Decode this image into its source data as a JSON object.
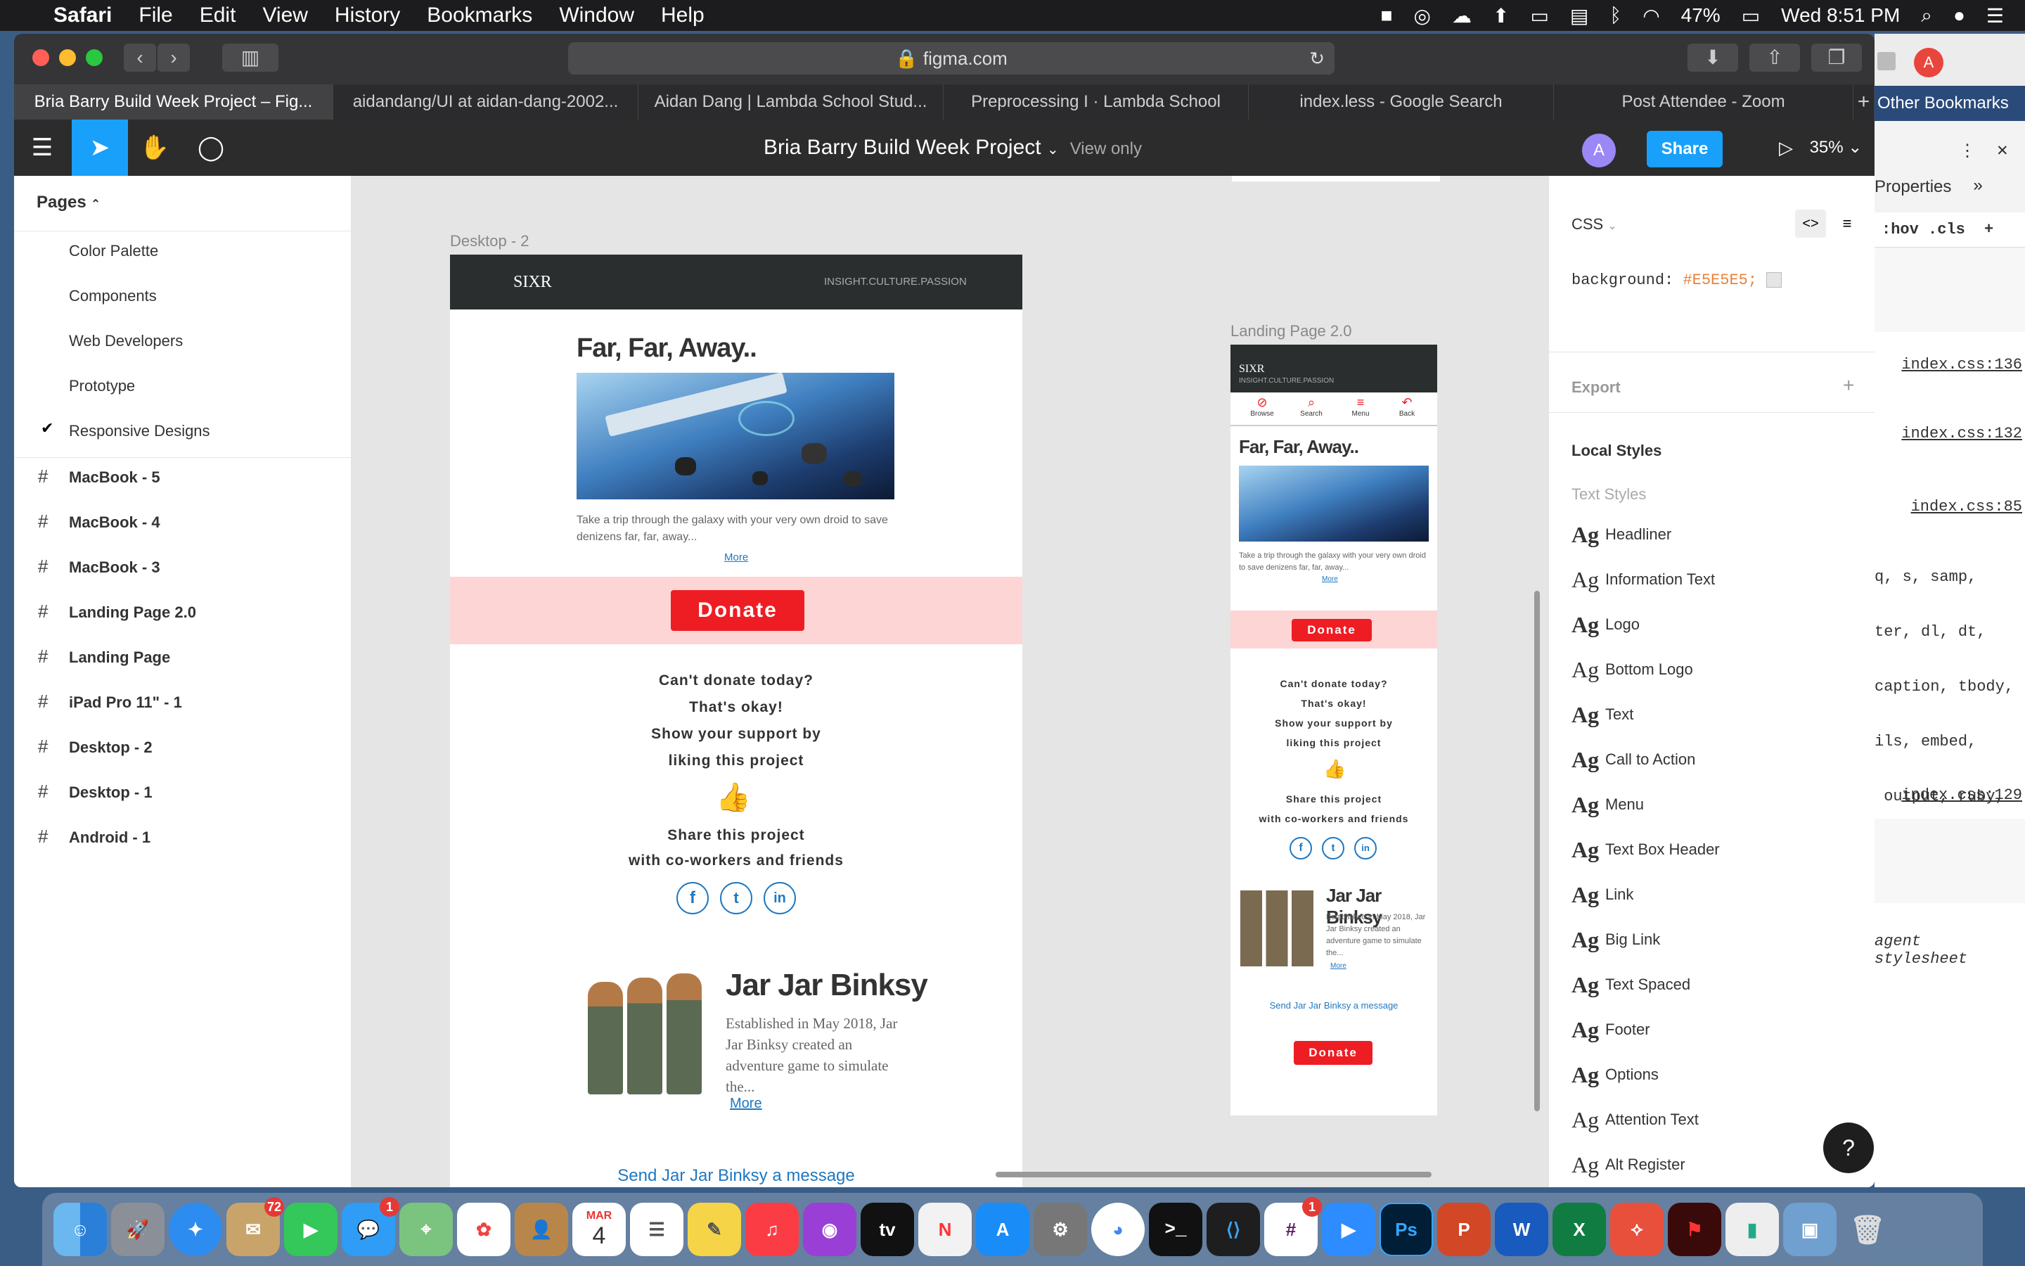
{
  "menubar": {
    "app": "Safari",
    "items": [
      "File",
      "Edit",
      "View",
      "History",
      "Bookmarks",
      "Window",
      "Help"
    ],
    "battery": "47%",
    "clock": "Wed 8:51 PM"
  },
  "browser": {
    "url": "figma.com",
    "tabs": [
      "Bria Barry Build Week Project – Fig...",
      "aidandang/UI at aidan-dang-2002...",
      "Aidan Dang | Lambda School Stud...",
      "Preprocessing I · Lambda School",
      "index.less - Google Search",
      "Post Attendee - Zoom"
    ],
    "other_bookmarks": "Other Bookmarks"
  },
  "figma": {
    "title": "Bria Barry Build Week Project",
    "view_only": "View only",
    "avatar": "A",
    "share": "Share",
    "zoom": "35%"
  },
  "pages": {
    "header": "Pages",
    "items": [
      "Color Palette",
      "Components",
      "Web Developers",
      "Prototype",
      "Responsive Designs"
    ],
    "layers": [
      "MacBook - 5",
      "MacBook - 4",
      "MacBook - 3",
      "Landing Page 2.0",
      "Landing Page",
      "iPad Pro 11\" - 1",
      "Desktop - 2",
      "Desktop - 1",
      "Android - 1"
    ]
  },
  "canvas": {
    "frame1_label": "Desktop - 2",
    "frame2_label": "Landing Page 2.0",
    "logo": "SIXR",
    "tagline": "INSIGHT.CULTURE.PASSION",
    "nav": [
      "Browse",
      "Search",
      "Menu",
      "Back"
    ],
    "hero_title": "Far, Far, Away..",
    "hero_desc": "Take a trip through the galaxy with your very own droid to save denizens far, far, away...",
    "more": "More",
    "donate": "Donate",
    "cant1": "Can't donate today?",
    "cant2": "That's okay!",
    "support1": "Show your support by",
    "support2": "liking this project",
    "share1": "Share this project",
    "share2": "with co-workers and friends",
    "profile_name": "Jar Jar Binksy",
    "profile_desc": "Established in May 2018, Jar Jar Binksy created an adventure game to simulate the...",
    "send_message": "Send Jar Jar Binksy a message"
  },
  "inspect": {
    "mode": "CSS",
    "css_prop": "background:",
    "css_value": "#E5E5E5;",
    "export": "Export",
    "local_styles": "Local Styles",
    "text_styles": "Text Styles",
    "styles": [
      "Headliner",
      "Information Text",
      "Logo",
      "Bottom Logo",
      "Text",
      "Call to Action",
      "Menu",
      "Text Box Header",
      "Link",
      "Big Link",
      "Text Spaced",
      "Footer",
      "Options",
      "Attention Text",
      "Alt Register"
    ]
  },
  "devtools": {
    "tab": "Properties",
    "filters": ":hov  .cls",
    "refs": [
      "index.css:136",
      "index.css:132",
      "index.css:85",
      "index.css:129"
    ],
    "code": [
      "q, s, samp,",
      "ter, dl, dt,",
      "caption, tbody,",
      "ils, embed,",
      " output, ruby,"
    ],
    "ua": "agent stylesheet"
  },
  "dock": {
    "mail_badge": "72",
    "messages_badge": "1",
    "slack_badge": "1",
    "calendar_month": "MAR",
    "calendar_day": "4"
  }
}
